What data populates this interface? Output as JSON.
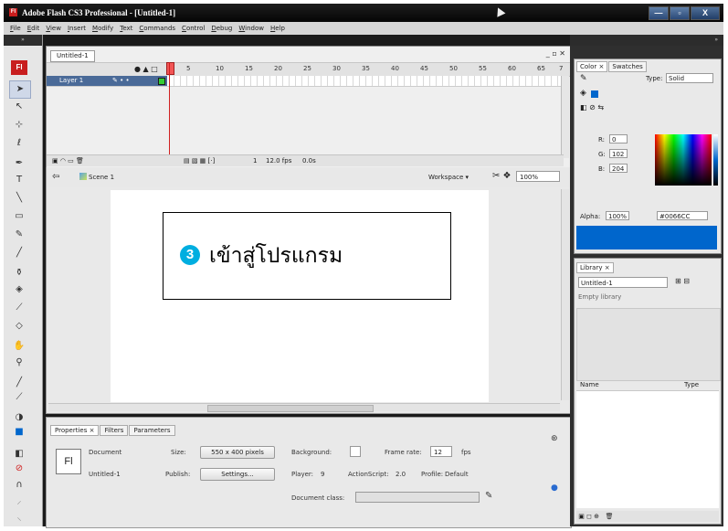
{
  "window": {
    "title": "Adobe Flash CS3 Professional - [Untitled-1]",
    "app_icon_label": "Fl",
    "min_glyph": "—",
    "max_glyph": "▫",
    "close_glyph": "X"
  },
  "menu": [
    "File",
    "Edit",
    "View",
    "Insert",
    "Modify",
    "Text",
    "Commands",
    "Control",
    "Debug",
    "Window",
    "Help"
  ],
  "tools": {
    "logo": "Fl",
    "collapse_glyph": "»"
  },
  "document": {
    "tab_label": "Untitled-1",
    "window_controls": "_ ▫ ✕"
  },
  "timeline": {
    "frame_numbers": [
      "5",
      "10",
      "15",
      "20",
      "25",
      "30",
      "35",
      "40",
      "45",
      "50",
      "55",
      "60",
      "65",
      "7"
    ],
    "layer_name": "Layer 1",
    "header_icons": "● ▲ □",
    "fps": "12.0 fps",
    "time": "0.0s",
    "current_frame": "1"
  },
  "scene": {
    "name": "Scene 1",
    "workspace_label": "Workspace ▾",
    "zoom": "100%"
  },
  "callout": {
    "number": "3",
    "text": "เข้าสู่โปรแกรม"
  },
  "properties": {
    "tabs": [
      "Properties ×",
      "Filters",
      "Parameters"
    ],
    "doc_label": "Document",
    "doc_name": "Untitled-1",
    "size_label": "Size:",
    "size_value": "550 x 400 pixels",
    "publish_label": "Publish:",
    "settings_button": "Settings...",
    "background_label": "Background:",
    "framerate_label": "Frame rate:",
    "framerate_value": "12",
    "fps_label": "fps",
    "player_label": "Player:",
    "player_value": "9",
    "actionscript_label": "ActionScript:",
    "actionscript_value": "2.0",
    "profile_label": "Profile:",
    "profile_value": "Default",
    "doc_class_label": "Document class:",
    "fl_icon": "Fl"
  },
  "color_panel": {
    "tabs": [
      "Color ×",
      "Swatches"
    ],
    "type_label": "Type:",
    "type_value": "Solid",
    "r_label": "R:",
    "r_value": "0",
    "g_label": "G:",
    "g_value": "102",
    "b_label": "B:",
    "b_value": "204",
    "alpha_label": "Alpha:",
    "alpha_value": "100%",
    "hex_value": "#0066CC",
    "fill_color": "#0066cc"
  },
  "library": {
    "tab": "Library ×",
    "doc_select": "Untitled-1",
    "empty_text": "Empty library",
    "col_name": "Name",
    "col_type": "Type"
  }
}
